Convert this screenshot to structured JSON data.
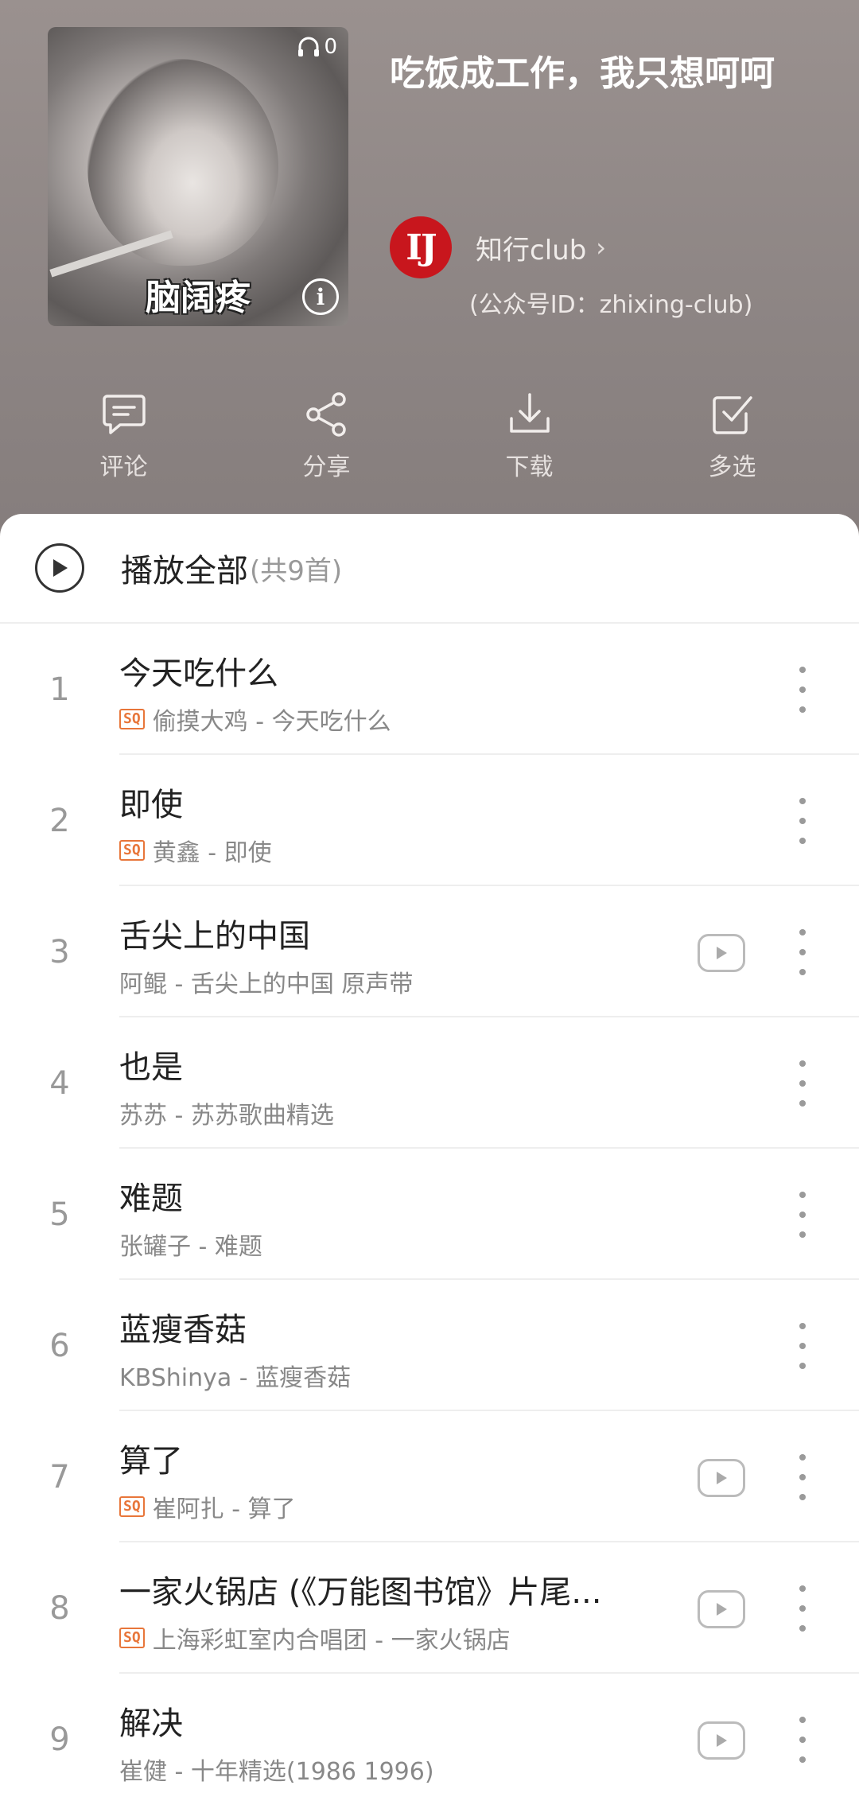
{
  "header": {
    "cover": {
      "play_count": "0",
      "caption": "脑阔疼",
      "info_icon": "info-icon"
    },
    "title": "吃饭成工作，我只想呵呵",
    "creator": {
      "logo_text": "IJ",
      "name": "知行club",
      "chevron": "›",
      "account_id": "(公众号ID：zhixing-club)"
    },
    "actions": [
      {
        "label": "评论",
        "icon": "comment-icon"
      },
      {
        "label": "分享",
        "icon": "share-icon"
      },
      {
        "label": "下载",
        "icon": "download-icon"
      },
      {
        "label": "多选",
        "icon": "multi-select-icon"
      }
    ]
  },
  "playall": {
    "label": "播放全部",
    "count": "(共9首)"
  },
  "songs": [
    {
      "index": "1",
      "title": "今天吃什么",
      "artist_album": "偷摸大鸡 - 今天吃什么",
      "sq": true,
      "mv": false
    },
    {
      "index": "2",
      "title": "即使",
      "artist_album": "黄鑫 - 即使",
      "sq": true,
      "mv": false
    },
    {
      "index": "3",
      "title": "舌尖上的中国",
      "artist_album": "阿鲲 - 舌尖上的中国 原声带",
      "sq": false,
      "mv": true
    },
    {
      "index": "4",
      "title": "也是",
      "artist_album": "苏苏 - 苏苏歌曲精选",
      "sq": false,
      "mv": false
    },
    {
      "index": "5",
      "title": "难题",
      "artist_album": "张罐子 - 难题",
      "sq": false,
      "mv": false
    },
    {
      "index": "6",
      "title": "蓝瘦香菇",
      "artist_album": "KBShinya - 蓝瘦香菇",
      "sq": false,
      "mv": false
    },
    {
      "index": "7",
      "title": "算了",
      "artist_album": "崔阿扎 - 算了",
      "sq": true,
      "mv": true
    },
    {
      "index": "8",
      "title": "一家火锅店 (《万能图书馆》片尾...",
      "artist_album": "上海彩虹室内合唱团 - 一家火锅店",
      "sq": true,
      "mv": true
    },
    {
      "index": "9",
      "title": "解决",
      "artist_album": "崔健 - 十年精选(1986 1996)",
      "sq": false,
      "mv": true
    }
  ],
  "badges": {
    "sq_label": "SQ"
  },
  "colors": {
    "header_bg": "#8f8786",
    "sq_orange": "#e8763a",
    "logo_red": "#c8161d"
  }
}
